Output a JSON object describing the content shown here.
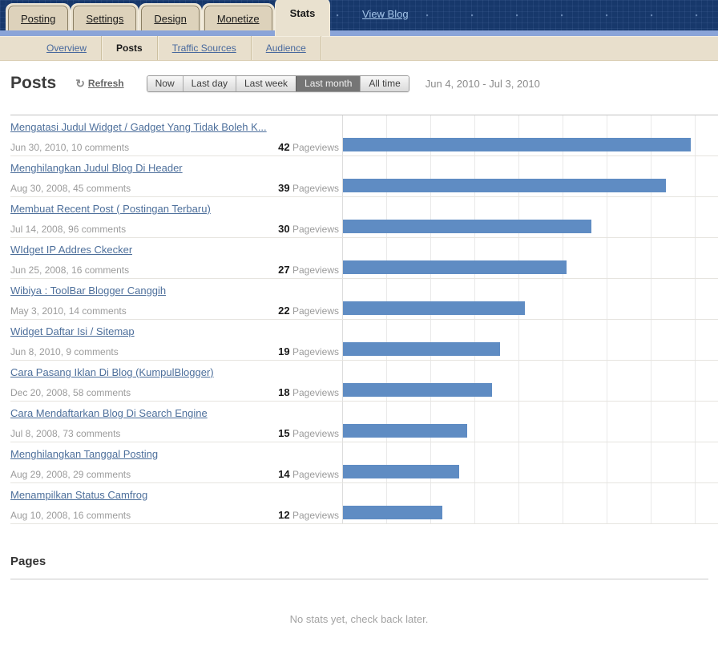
{
  "nav": {
    "tabs": [
      {
        "label": "Posting",
        "active": false
      },
      {
        "label": "Settings",
        "active": false
      },
      {
        "label": "Design",
        "active": false
      },
      {
        "label": "Monetize",
        "active": false
      },
      {
        "label": "Stats",
        "active": true
      }
    ],
    "view_blog_label": "View Blog"
  },
  "subnav": {
    "items": [
      {
        "label": "Overview",
        "active": false
      },
      {
        "label": "Posts",
        "active": true
      },
      {
        "label": "Traffic Sources",
        "active": false
      },
      {
        "label": "Audience",
        "active": false
      }
    ]
  },
  "posts_section": {
    "title": "Posts",
    "refresh_label": "Refresh",
    "filters": [
      "Now",
      "Last day",
      "Last week",
      "Last month",
      "All time"
    ],
    "active_filter": "Last month",
    "date_range": "Jun 4, 2010 - Jul 3, 2010",
    "pageviews_label": "Pageviews"
  },
  "chart_data": {
    "type": "bar",
    "orientation": "horizontal",
    "title": "Posts pageviews, Last month",
    "unit": "Pageviews",
    "xlim": [
      0,
      45
    ],
    "gridlines": true,
    "bar_color": "#5f8cc3",
    "categories": [
      "Mengatasi Judul Widget / Gadget Yang Tidak Boleh K...",
      "Menghilangkan Judul Blog Di Header",
      "Membuat Recent Post ( Postingan Terbaru)",
      "WIdget IP Addres Ckecker",
      "Wibiya : ToolBar Blogger Canggih",
      "Widget Daftar Isi / Sitemap",
      "Cara Pasang Iklan Di Blog (KumpulBlogger)",
      "Cara Mendaftarkan Blog Di Search Engine",
      "Menghilangkan Tanggal Posting",
      "Menampilkan Status Camfrog"
    ],
    "meta": [
      "Jun 30, 2010, 10 comments",
      "Aug 30, 2008, 45 comments",
      "Jul 14, 2008, 96 comments",
      "Jun 25, 2008, 16 comments",
      "May 3, 2010, 14 comments",
      "Jun 8, 2010, 9 comments",
      "Dec 20, 2008, 58 comments",
      "Jul 8, 2008, 73 comments",
      "Aug 29, 2008, 29 comments",
      "Aug 10, 2008, 16 comments"
    ],
    "values": [
      42,
      39,
      30,
      27,
      22,
      19,
      18,
      15,
      14,
      12
    ]
  },
  "pages_section": {
    "title": "Pages",
    "empty_text": "No stats yet, check back later."
  },
  "colors": {
    "header_navy": "#17386b",
    "header_stripe": "#8aa4d8",
    "subnav_beige": "#e8dfcc",
    "active_tab_bg": "#f9f4e7",
    "bar": "#5f8cc3",
    "post_link": "#4d6f9b"
  }
}
